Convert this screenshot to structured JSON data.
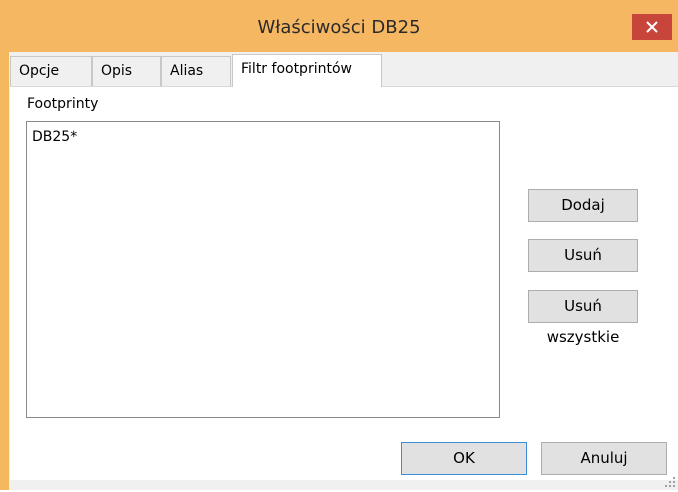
{
  "window": {
    "title": "Właściwości DB25",
    "close_icon": "close-icon"
  },
  "tabs": [
    {
      "label": "Opcje",
      "active": false
    },
    {
      "label": "Opis",
      "active": false
    },
    {
      "label": "Alias",
      "active": false
    },
    {
      "label": "Filtr footprintów",
      "active": true
    }
  ],
  "footprints": {
    "label": "Footprinty",
    "items": [
      "DB25*"
    ]
  },
  "side_buttons": {
    "add": "Dodaj",
    "remove": "Usuń",
    "remove_all": "Usuń wszystkie"
  },
  "footer": {
    "ok": "OK",
    "cancel": "Anuluj"
  },
  "colors": {
    "titlebar": "#f5b762",
    "close_button": "#c7453a",
    "client": "#f0f0f0"
  }
}
